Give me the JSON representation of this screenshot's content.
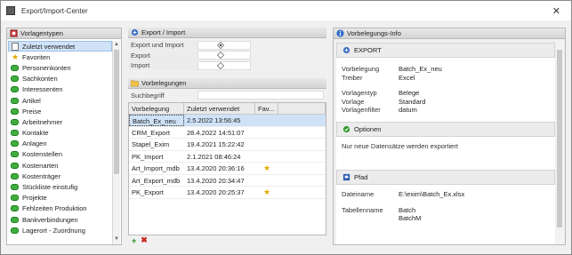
{
  "window": {
    "title": "Export/Import-Center",
    "close_glyph": "✕"
  },
  "left": {
    "header": "Vorlagentypen",
    "items": [
      {
        "label": "Zuletzt verwendet",
        "icon": "document-icon",
        "selected": true
      },
      {
        "label": "Favoriten",
        "icon": "star-icon"
      },
      {
        "label": "Personenkonten",
        "icon": "green-pill-icon"
      },
      {
        "label": "Sachkonten",
        "icon": "green-pill-icon"
      },
      {
        "label": "Interessenten",
        "icon": "green-pill-icon"
      },
      {
        "label": "Artikel",
        "icon": "green-pill-icon"
      },
      {
        "label": "Preise",
        "icon": "green-pill-icon"
      },
      {
        "label": "Arbeitnehmer",
        "icon": "green-pill-icon"
      },
      {
        "label": "Kontakte",
        "icon": "green-pill-icon"
      },
      {
        "label": "Anlagen",
        "icon": "green-pill-icon"
      },
      {
        "label": "Kostenstellen",
        "icon": "green-pill-icon"
      },
      {
        "label": "Kostenarten",
        "icon": "green-pill-icon"
      },
      {
        "label": "Kostenträger",
        "icon": "green-pill-icon"
      },
      {
        "label": "Stückliste einstufig",
        "icon": "green-pill-icon"
      },
      {
        "label": "Projekte",
        "icon": "green-pill-icon"
      },
      {
        "label": "Fehlzeiten Produktion",
        "icon": "green-pill-icon"
      },
      {
        "label": "Bankverbindungen",
        "icon": "green-pill-icon"
      },
      {
        "label": "Lagerort - Zuordnung",
        "icon": "green-pill-icon"
      }
    ]
  },
  "center": {
    "export_import_header": "Export / Import",
    "options": [
      {
        "label": "Export und Import",
        "checked": true
      },
      {
        "label": "Export",
        "checked": false
      },
      {
        "label": "Import",
        "checked": false
      }
    ],
    "vorbelegungen_header": "Vorbelegungen",
    "search_label": "Suchbegriff",
    "search_value": "",
    "columns": [
      "Vorbelegung",
      "Zuletzt verwendet",
      "Fav..."
    ],
    "rows": [
      {
        "name": "Batch_Ex_neu",
        "date": "2.5.2022 13:56:45",
        "fav": false,
        "selected": true
      },
      {
        "name": "CRM_Export",
        "date": "28.4.2022 14:51:07",
        "fav": false
      },
      {
        "name": "Stapel_Exim",
        "date": "19.4.2021 15:22:42",
        "fav": false
      },
      {
        "name": "PK_Import",
        "date": "2.1.2021 08:46:24",
        "fav": false
      },
      {
        "name": "Art_Import_mdb",
        "date": "13.4.2020 20:36:16",
        "fav": true
      },
      {
        "name": "Art_Export_mdb",
        "date": "13.4.2020 20:34:47",
        "fav": false
      },
      {
        "name": "PK_Export",
        "date": "13.4.2020 20:25:37",
        "fav": true
      }
    ],
    "add_glyph": "+",
    "delete_glyph": "✖"
  },
  "right": {
    "header": "Vorbelegungs-Info",
    "export_section": "EXPORT",
    "export_fields": [
      {
        "k": "Vorbelegung",
        "v": "Batch_Ex_neu"
      },
      {
        "k": "Treiber",
        "v": "Excel"
      }
    ],
    "export_fields2": [
      {
        "k": "Vorlagentyp",
        "v": "Belege"
      },
      {
        "k": "Vorlage",
        "v": "Standard"
      },
      {
        "k": "Vorlagenfilter",
        "v": "datum"
      }
    ],
    "options_section": "Optionen",
    "options_text": "Nur neue Datensätze werden exportiert",
    "path_section": "Pfad",
    "path_fields": [
      {
        "k": "Dateiname",
        "v": "E:\\exim\\Batch_Ex.xlsx"
      }
    ],
    "table_label": "Tabellenname",
    "table_values": [
      "Batch",
      "BatchM"
    ]
  }
}
